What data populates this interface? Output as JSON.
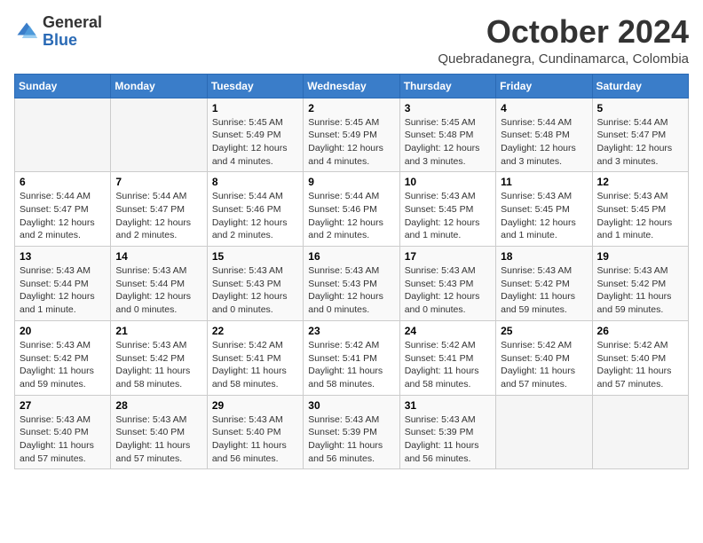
{
  "logo": {
    "general": "General",
    "blue": "Blue"
  },
  "header": {
    "title": "October 2024",
    "subtitle": "Quebradanegra, Cundinamarca, Colombia"
  },
  "days_of_week": [
    "Sunday",
    "Monday",
    "Tuesday",
    "Wednesday",
    "Thursday",
    "Friday",
    "Saturday"
  ],
  "weeks": [
    [
      {
        "day": "",
        "info": ""
      },
      {
        "day": "",
        "info": ""
      },
      {
        "day": "1",
        "info": "Sunrise: 5:45 AM\nSunset: 5:49 PM\nDaylight: 12 hours and 4 minutes."
      },
      {
        "day": "2",
        "info": "Sunrise: 5:45 AM\nSunset: 5:49 PM\nDaylight: 12 hours and 4 minutes."
      },
      {
        "day": "3",
        "info": "Sunrise: 5:45 AM\nSunset: 5:48 PM\nDaylight: 12 hours and 3 minutes."
      },
      {
        "day": "4",
        "info": "Sunrise: 5:44 AM\nSunset: 5:48 PM\nDaylight: 12 hours and 3 minutes."
      },
      {
        "day": "5",
        "info": "Sunrise: 5:44 AM\nSunset: 5:47 PM\nDaylight: 12 hours and 3 minutes."
      }
    ],
    [
      {
        "day": "6",
        "info": "Sunrise: 5:44 AM\nSunset: 5:47 PM\nDaylight: 12 hours and 2 minutes."
      },
      {
        "day": "7",
        "info": "Sunrise: 5:44 AM\nSunset: 5:47 PM\nDaylight: 12 hours and 2 minutes."
      },
      {
        "day": "8",
        "info": "Sunrise: 5:44 AM\nSunset: 5:46 PM\nDaylight: 12 hours and 2 minutes."
      },
      {
        "day": "9",
        "info": "Sunrise: 5:44 AM\nSunset: 5:46 PM\nDaylight: 12 hours and 2 minutes."
      },
      {
        "day": "10",
        "info": "Sunrise: 5:43 AM\nSunset: 5:45 PM\nDaylight: 12 hours and 1 minute."
      },
      {
        "day": "11",
        "info": "Sunrise: 5:43 AM\nSunset: 5:45 PM\nDaylight: 12 hours and 1 minute."
      },
      {
        "day": "12",
        "info": "Sunrise: 5:43 AM\nSunset: 5:45 PM\nDaylight: 12 hours and 1 minute."
      }
    ],
    [
      {
        "day": "13",
        "info": "Sunrise: 5:43 AM\nSunset: 5:44 PM\nDaylight: 12 hours and 1 minute."
      },
      {
        "day": "14",
        "info": "Sunrise: 5:43 AM\nSunset: 5:44 PM\nDaylight: 12 hours and 0 minutes."
      },
      {
        "day": "15",
        "info": "Sunrise: 5:43 AM\nSunset: 5:43 PM\nDaylight: 12 hours and 0 minutes."
      },
      {
        "day": "16",
        "info": "Sunrise: 5:43 AM\nSunset: 5:43 PM\nDaylight: 12 hours and 0 minutes."
      },
      {
        "day": "17",
        "info": "Sunrise: 5:43 AM\nSunset: 5:43 PM\nDaylight: 12 hours and 0 minutes."
      },
      {
        "day": "18",
        "info": "Sunrise: 5:43 AM\nSunset: 5:42 PM\nDaylight: 11 hours and 59 minutes."
      },
      {
        "day": "19",
        "info": "Sunrise: 5:43 AM\nSunset: 5:42 PM\nDaylight: 11 hours and 59 minutes."
      }
    ],
    [
      {
        "day": "20",
        "info": "Sunrise: 5:43 AM\nSunset: 5:42 PM\nDaylight: 11 hours and 59 minutes."
      },
      {
        "day": "21",
        "info": "Sunrise: 5:43 AM\nSunset: 5:42 PM\nDaylight: 11 hours and 58 minutes."
      },
      {
        "day": "22",
        "info": "Sunrise: 5:42 AM\nSunset: 5:41 PM\nDaylight: 11 hours and 58 minutes."
      },
      {
        "day": "23",
        "info": "Sunrise: 5:42 AM\nSunset: 5:41 PM\nDaylight: 11 hours and 58 minutes."
      },
      {
        "day": "24",
        "info": "Sunrise: 5:42 AM\nSunset: 5:41 PM\nDaylight: 11 hours and 58 minutes."
      },
      {
        "day": "25",
        "info": "Sunrise: 5:42 AM\nSunset: 5:40 PM\nDaylight: 11 hours and 57 minutes."
      },
      {
        "day": "26",
        "info": "Sunrise: 5:42 AM\nSunset: 5:40 PM\nDaylight: 11 hours and 57 minutes."
      }
    ],
    [
      {
        "day": "27",
        "info": "Sunrise: 5:43 AM\nSunset: 5:40 PM\nDaylight: 11 hours and 57 minutes."
      },
      {
        "day": "28",
        "info": "Sunrise: 5:43 AM\nSunset: 5:40 PM\nDaylight: 11 hours and 57 minutes."
      },
      {
        "day": "29",
        "info": "Sunrise: 5:43 AM\nSunset: 5:40 PM\nDaylight: 11 hours and 56 minutes."
      },
      {
        "day": "30",
        "info": "Sunrise: 5:43 AM\nSunset: 5:39 PM\nDaylight: 11 hours and 56 minutes."
      },
      {
        "day": "31",
        "info": "Sunrise: 5:43 AM\nSunset: 5:39 PM\nDaylight: 11 hours and 56 minutes."
      },
      {
        "day": "",
        "info": ""
      },
      {
        "day": "",
        "info": ""
      }
    ]
  ]
}
